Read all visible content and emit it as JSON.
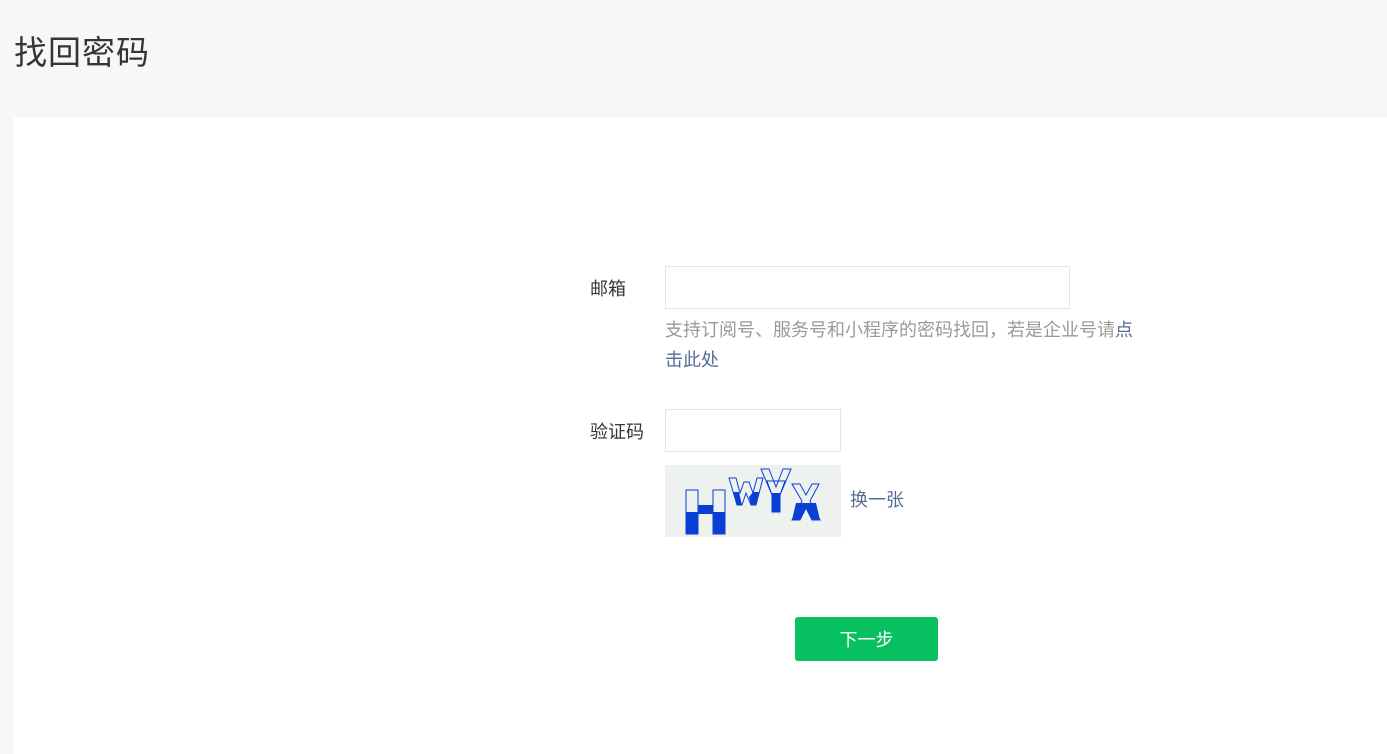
{
  "page": {
    "title": "找回密码"
  },
  "form": {
    "email_label": "邮箱",
    "email_value": "",
    "hint_text": "支持订阅号、服务号和小程序的密码找回，若是企业号请",
    "hint_link": "点击此处",
    "captcha_label": "验证码",
    "captcha_value": "",
    "refresh_link": "换一张",
    "next_button": "下一步"
  },
  "colors": {
    "accent": "#07c160",
    "link": "#576b95",
    "hint": "#9a9a9a",
    "captcha_glyph": "#0a3fd6"
  }
}
